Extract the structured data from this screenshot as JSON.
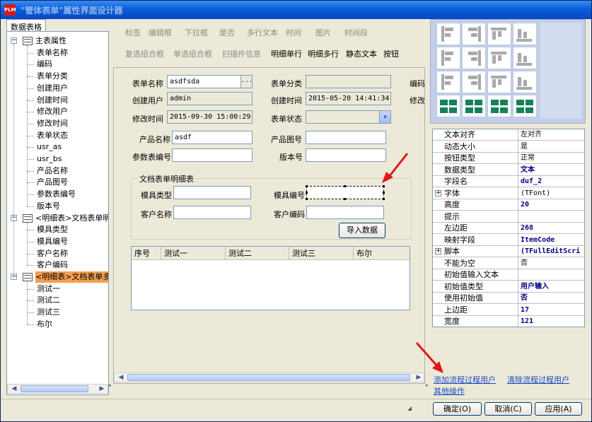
{
  "window": {
    "title": "\"管体表单\"属性界面设计器",
    "logo_text": "PLM"
  },
  "left_tab": {
    "label": "数据表格"
  },
  "tree": {
    "items": [
      {
        "label": "主表属性",
        "level": 0
      },
      {
        "label": "表单名称",
        "level": 1
      },
      {
        "label": "编码",
        "level": 1
      },
      {
        "label": "表单分类",
        "level": 1
      },
      {
        "label": "创建用户",
        "level": 1
      },
      {
        "label": "创建时间",
        "level": 1
      },
      {
        "label": "修改用户",
        "level": 1
      },
      {
        "label": "修改时间",
        "level": 1
      },
      {
        "label": "表单状态",
        "level": 1
      },
      {
        "label": "usr_as",
        "level": 1
      },
      {
        "label": "usr_bs",
        "level": 1
      },
      {
        "label": "产品名称",
        "level": 1
      },
      {
        "label": "产品图号",
        "level": 1
      },
      {
        "label": "参数表编号",
        "level": 1
      },
      {
        "label": "版本号",
        "level": 1
      },
      {
        "label": "<明细表>文档表单明",
        "level": 0
      },
      {
        "label": "模具类型",
        "level": 1
      },
      {
        "label": "模具编号",
        "level": 1
      },
      {
        "label": "客户名称",
        "level": 1
      },
      {
        "label": "客户编码",
        "level": 1
      },
      {
        "label": "<明细表>文档表单多",
        "level": 0,
        "selected": true
      },
      {
        "label": "测试一",
        "level": 1
      },
      {
        "label": "测试二",
        "level": 1
      },
      {
        "label": "测试三",
        "level": 1
      },
      {
        "label": "布尔",
        "level": 1
      }
    ]
  },
  "toolbar": {
    "row1": [
      {
        "label": "标签",
        "enabled": false
      },
      {
        "label": "编辑框",
        "enabled": false
      },
      {
        "label": "下拉框",
        "enabled": false
      },
      {
        "label": "是否",
        "enabled": false
      },
      {
        "label": "多行文本",
        "enabled": false
      },
      {
        "label": "时间",
        "enabled": false
      },
      {
        "label": "图片",
        "enabled": false
      },
      {
        "label": "时间段",
        "enabled": false
      }
    ],
    "row2": [
      {
        "label": "复选组合框",
        "enabled": false
      },
      {
        "label": "单选组合框",
        "enabled": false
      },
      {
        "label": "扫描件信息",
        "enabled": false
      },
      {
        "label": "明细单行",
        "enabled": true
      },
      {
        "label": "明细多行",
        "enabled": true
      },
      {
        "label": "静态文本",
        "enabled": true
      },
      {
        "label": "按钮",
        "enabled": true
      }
    ]
  },
  "form": {
    "form_name_label": "表单名称",
    "form_name_value": "asdfsda",
    "form_name_ellipsis": "...",
    "form_category_label": "表单分类",
    "code_label": "编码",
    "create_user_label": "创建用户",
    "create_user_value": "admin",
    "create_time_label": "创建时间",
    "create_time_value": "2015-05-20 14:41:34",
    "modify_label_cut": "修改",
    "modify_time_label": "修改时间",
    "modify_time_value": "2015-09-30 15:00:29",
    "form_status_label": "表单状态",
    "product_name_label": "产品名称",
    "product_name_value": "asdf",
    "product_drawing_label": "产品图号",
    "param_table_label": "参数表编号",
    "version_label": "版本号",
    "group_title": "文档表单明细表",
    "mold_type_label": "模具类型",
    "mold_number_label": "模具编号",
    "customer_name_label": "客户名称",
    "customer_code_label": "客户编码",
    "import_button": "导入数据",
    "grid_columns": [
      "序号",
      "测试一",
      "测试二",
      "测试三",
      "布尔"
    ]
  },
  "properties": [
    {
      "name": "文本对齐",
      "value": "左对齐"
    },
    {
      "name": "动态大小",
      "value": "是"
    },
    {
      "name": "按钮类型",
      "value": "正常"
    },
    {
      "name": "数据类型",
      "value": "文本",
      "bold": true
    },
    {
      "name": "字段名",
      "value": "duf_2",
      "bold": true
    },
    {
      "name": "字体",
      "value": "(TFont)",
      "expand": true
    },
    {
      "name": "高度",
      "value": "20",
      "bold": true
    },
    {
      "name": "提示",
      "value": ""
    },
    {
      "name": "左边距",
      "value": "268",
      "bold": true
    },
    {
      "name": "映射字段",
      "value": "ItemCode",
      "bold": true
    },
    {
      "name": "脚本",
      "value": "(TFullEditScri",
      "bold": true,
      "expand": true
    },
    {
      "name": "不能为空",
      "value": "否"
    },
    {
      "name": "初始值输入文本",
      "value": ""
    },
    {
      "name": "初始值类型",
      "value": "用户输入",
      "bold": true
    },
    {
      "name": "使用初始值",
      "value": "否",
      "bold": true
    },
    {
      "name": "上边距",
      "value": "17",
      "bold": true
    },
    {
      "name": "宽度",
      "value": "121",
      "bold": true
    }
  ],
  "links": {
    "add_flow_user": "添加流程过程用户",
    "clear_flow_user": "清除流程过程用户",
    "other_ops": "其他操作"
  },
  "dialog_buttons": {
    "ok": "确定(O)",
    "cancel": "取消(C)",
    "apply": "应用(A)"
  },
  "colors": {
    "annotation_arrow": "#e01818",
    "selected_tree_item": "#f4a050",
    "titlebar": "#0a5fd8"
  },
  "icons": [
    "align-left-icon",
    "align-right-icon",
    "align-top-icon",
    "align-bottom-icon",
    "center-horizontal-icon",
    "center-vertical-icon",
    "same-width-icon",
    "same-height-icon",
    "space-horizontal-icon",
    "space-vertical-icon",
    "bring-front-icon",
    "send-back-icon",
    "grid-left-icon",
    "grid-right-icon",
    "grid-up-icon",
    "grid-down-icon"
  ]
}
